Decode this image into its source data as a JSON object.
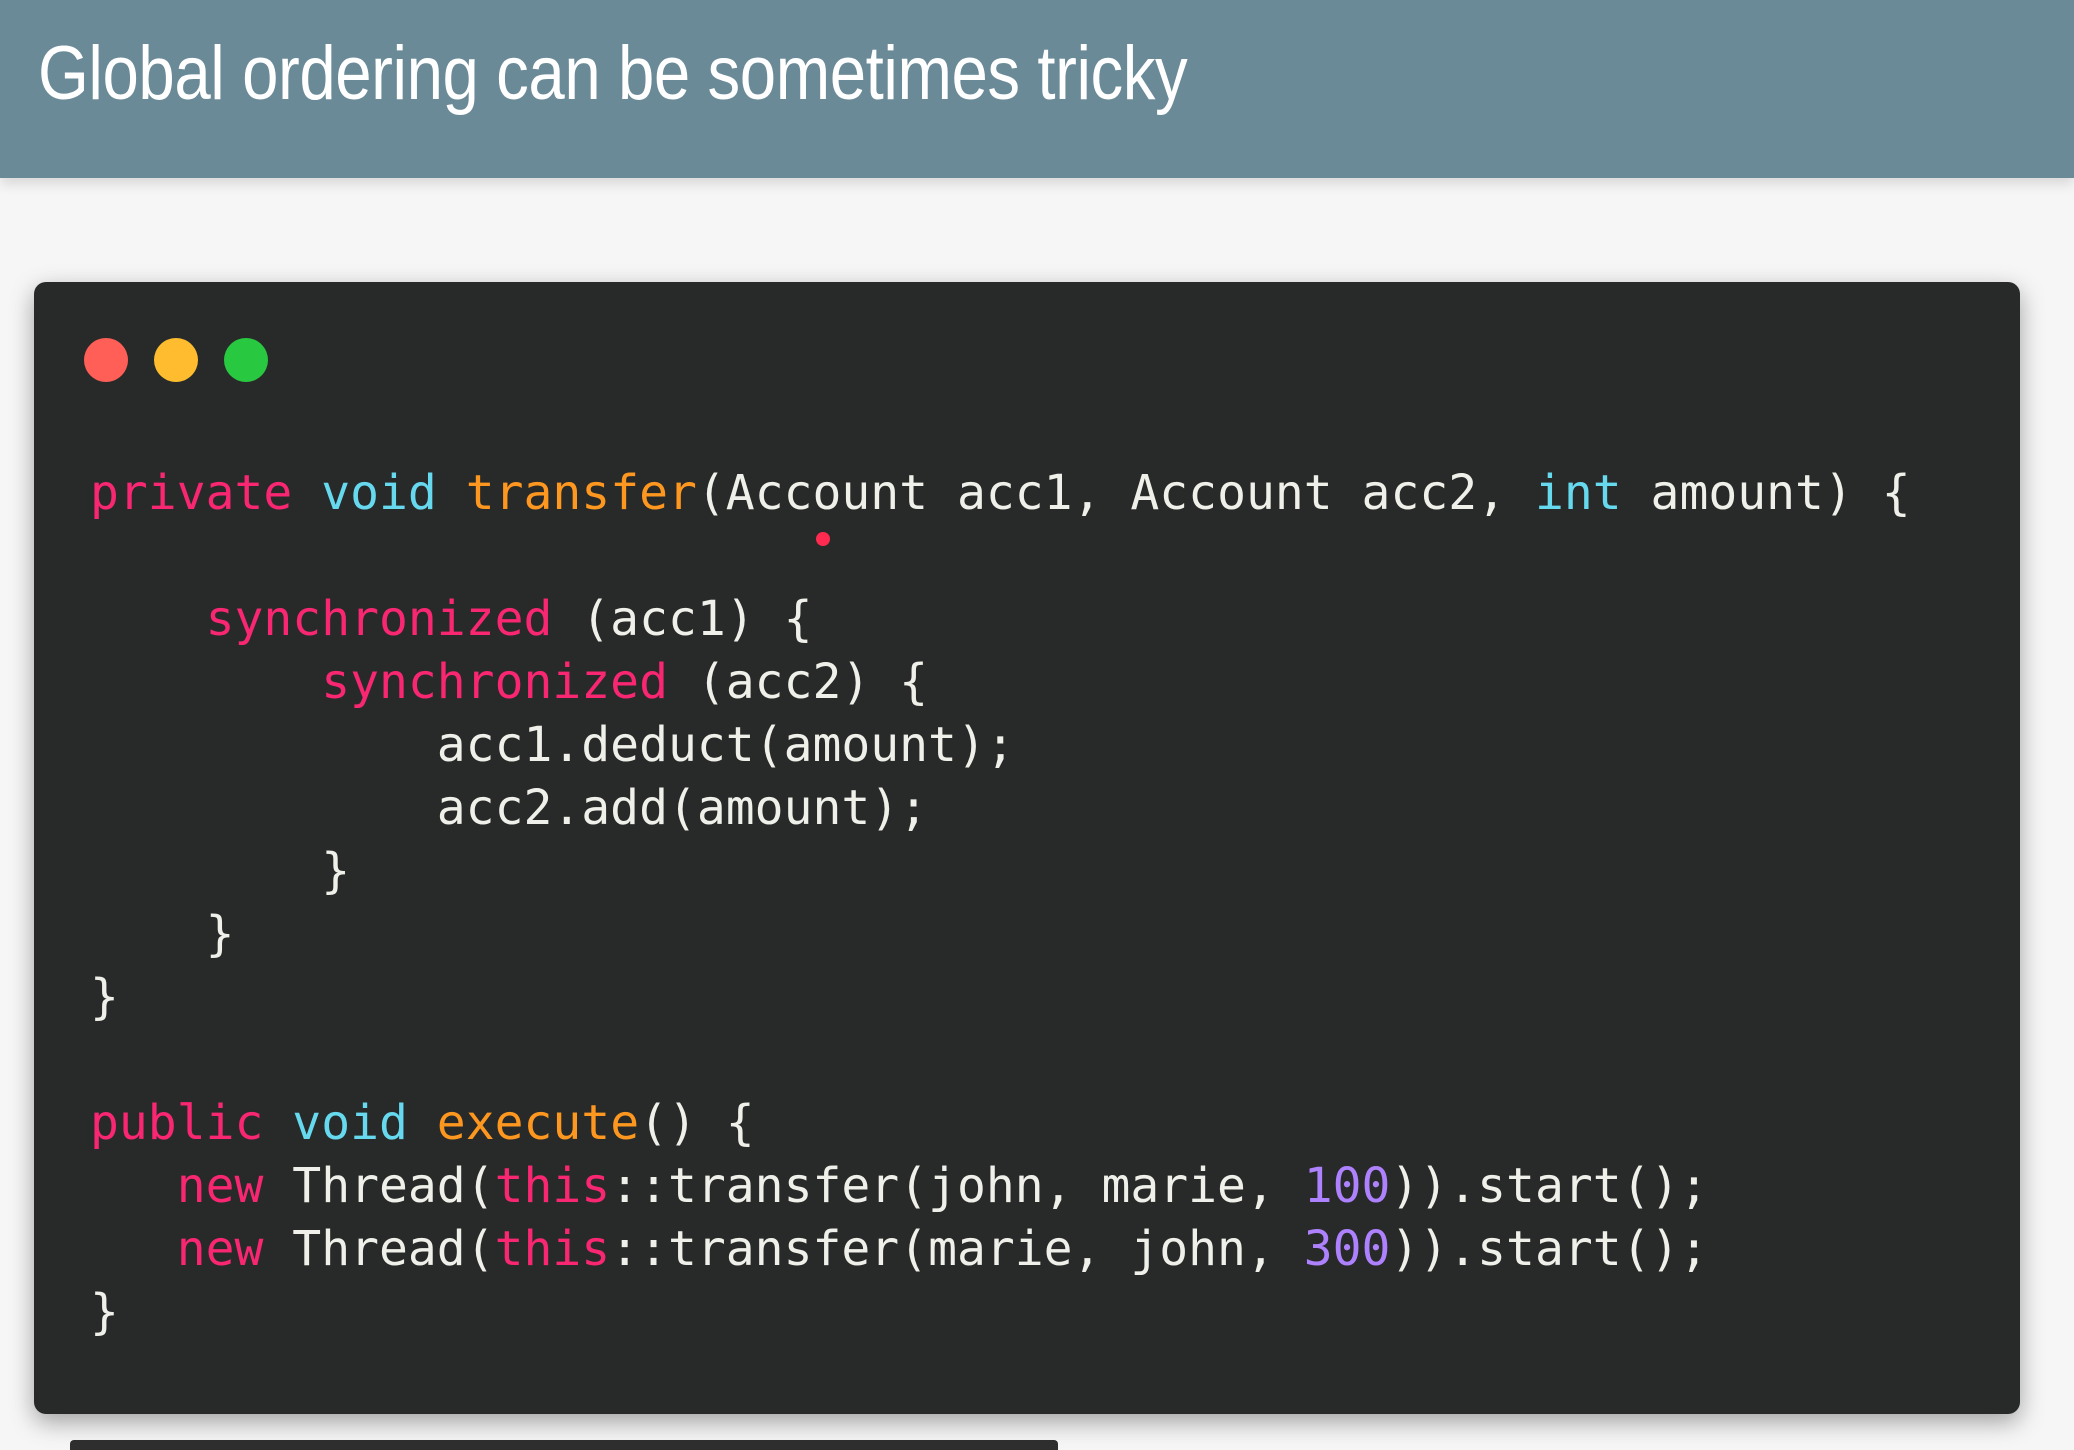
{
  "slide": {
    "title": "Global ordering can be sometimes tricky"
  },
  "window": {
    "controls": [
      {
        "name": "close-dot",
        "color": "#ff5f57"
      },
      {
        "name": "minimize-dot",
        "color": "#febc2e"
      },
      {
        "name": "zoom-dot",
        "color": "#28c840"
      }
    ]
  },
  "colors": {
    "keyword": "#f92672",
    "type": "#66d9ef",
    "function": "#fd971f",
    "number": "#ae81ff",
    "plain": "#f0f0ea"
  },
  "code": {
    "lines": [
      [
        [
          "keyword",
          "private"
        ],
        [
          "plain",
          " "
        ],
        [
          "type",
          "void"
        ],
        [
          "plain",
          " "
        ],
        [
          "function",
          "transfer"
        ],
        [
          "plain",
          "(Account acc1, Account acc2, "
        ],
        [
          "type",
          "int"
        ],
        [
          "plain",
          " amount) {"
        ]
      ],
      [],
      [
        [
          "plain",
          "    "
        ],
        [
          "keyword",
          "synchronized"
        ],
        [
          "plain",
          " (acc1) {"
        ]
      ],
      [
        [
          "plain",
          "        "
        ],
        [
          "keyword",
          "synchronized"
        ],
        [
          "plain",
          " (acc2) {"
        ]
      ],
      [
        [
          "plain",
          "            acc1.deduct(amount);"
        ]
      ],
      [
        [
          "plain",
          "            acc2.add(amount);"
        ]
      ],
      [
        [
          "plain",
          "        }"
        ]
      ],
      [
        [
          "plain",
          "    }"
        ]
      ],
      [
        [
          "plain",
          "}"
        ]
      ],
      [],
      [
        [
          "keyword",
          "public"
        ],
        [
          "plain",
          " "
        ],
        [
          "type",
          "void"
        ],
        [
          "plain",
          " "
        ],
        [
          "function",
          "execute"
        ],
        [
          "plain",
          "() {"
        ]
      ],
      [
        [
          "plain",
          "   "
        ],
        [
          "keyword",
          "new"
        ],
        [
          "plain",
          " Thread("
        ],
        [
          "keyword",
          "this"
        ],
        [
          "plain",
          "::transfer(john, marie, "
        ],
        [
          "number",
          "100"
        ],
        [
          "plain",
          ")).start();"
        ]
      ],
      [
        [
          "plain",
          "   "
        ],
        [
          "keyword",
          "new"
        ],
        [
          "plain",
          " Thread("
        ],
        [
          "keyword",
          "this"
        ],
        [
          "plain",
          "::transfer(marie, john, "
        ],
        [
          "number",
          "300"
        ],
        [
          "plain",
          ")).start();"
        ]
      ],
      [
        [
          "plain",
          "}"
        ]
      ]
    ]
  }
}
